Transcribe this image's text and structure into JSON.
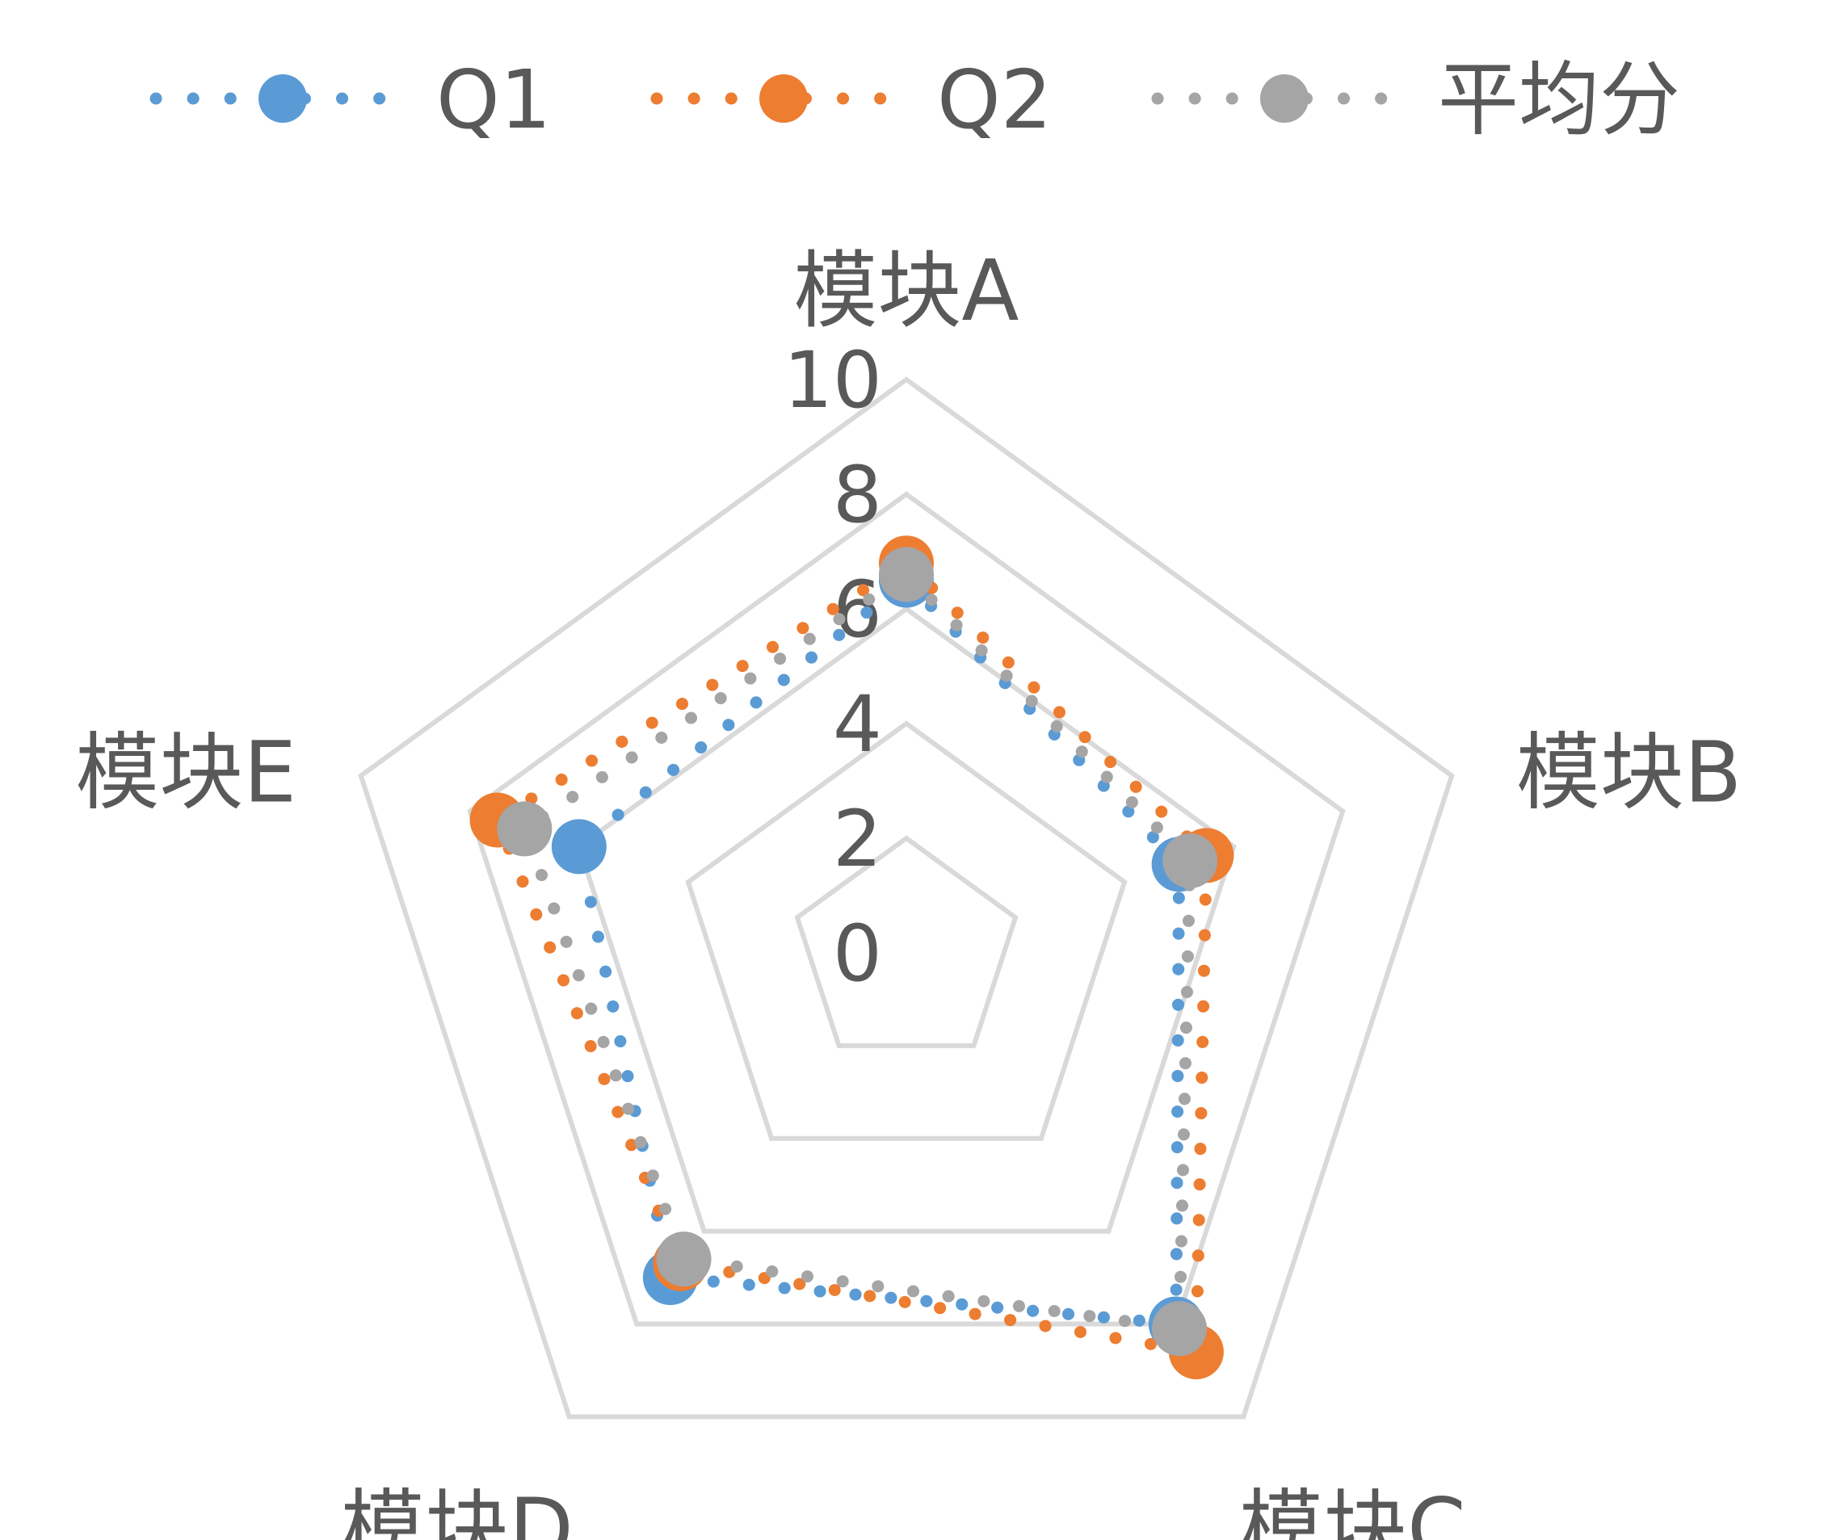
{
  "chart_data": {
    "type": "radar",
    "categories": [
      "模块A",
      "模块B",
      "模块C",
      "模块D",
      "模块E"
    ],
    "series": [
      {
        "name": "Q1",
        "values": [
          6.5,
          5.0,
          8.0,
          7.0,
          6.0
        ]
      },
      {
        "name": "Q2",
        "values": [
          6.8,
          5.5,
          8.6,
          6.7,
          7.5
        ]
      },
      {
        "name": "平均分",
        "values": [
          6.6,
          5.2,
          8.1,
          6.6,
          7.0
        ]
      }
    ],
    "rlim": [
      0,
      10
    ],
    "ticks": [
      "0",
      "2",
      "4",
      "6",
      "8",
      "10"
    ],
    "legend_position": "top",
    "grid": true,
    "colors": {
      "Q1": "#5B9BD5",
      "Q2": "#ED7D31",
      "平均分": "#A5A5A5",
      "grid": "#D9D9D9",
      "text": "#595959"
    }
  }
}
